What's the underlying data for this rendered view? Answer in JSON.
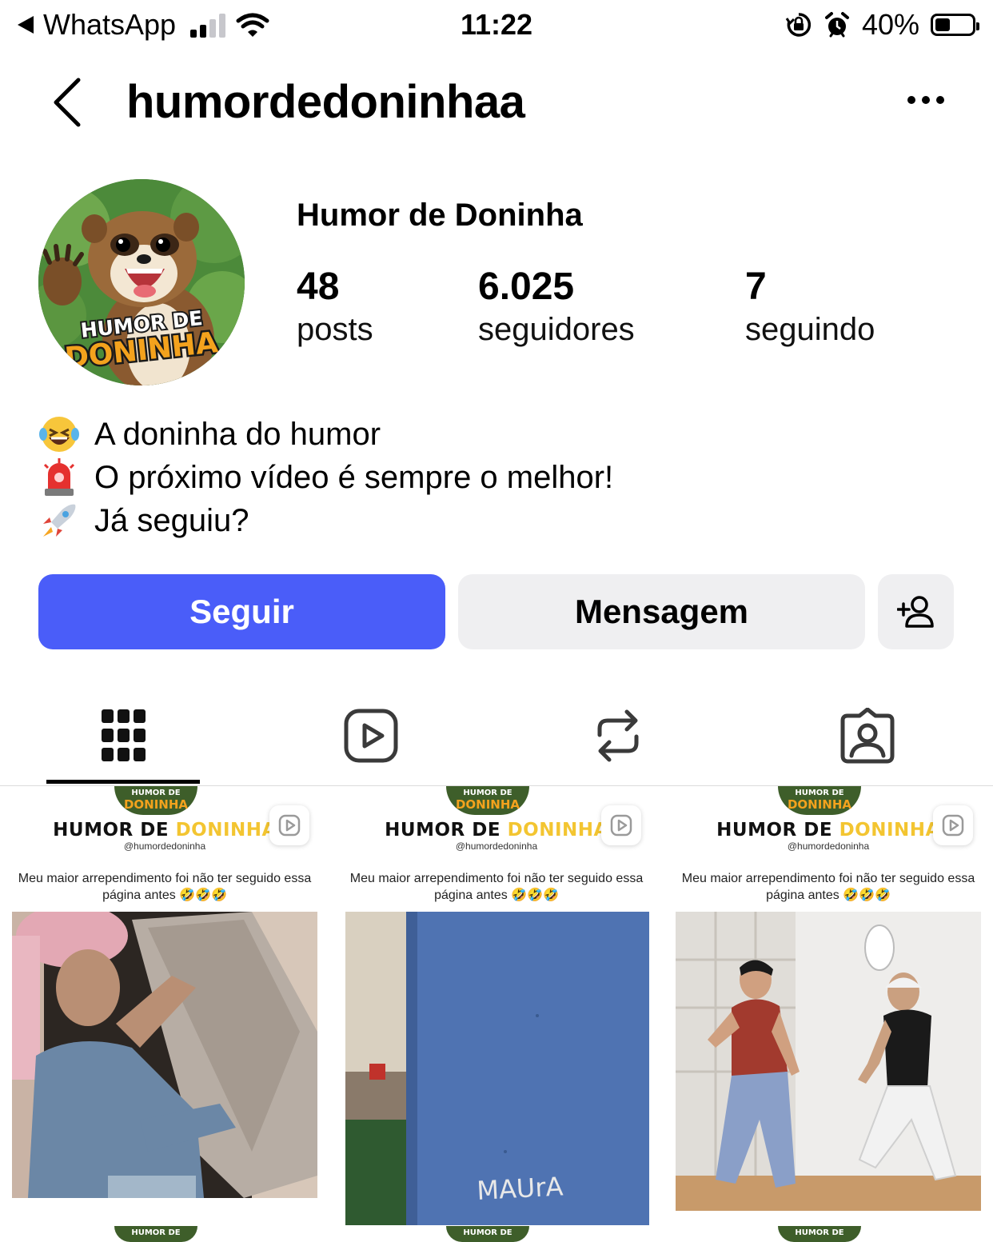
{
  "status_bar": {
    "back_app": "WhatsApp",
    "time": "11:22",
    "battery": "40%",
    "battery_level": 0.4
  },
  "header": {
    "username": "humordedoninhaa",
    "back_icon": "chevron-left-icon",
    "more_icon": "ellipsis-icon"
  },
  "profile": {
    "full_name": "Humor de Doninha",
    "avatar_text_1": "HUMOR DE",
    "avatar_text_2": "DONINHA",
    "stats": [
      {
        "value": "48",
        "label": "posts"
      },
      {
        "value": "6.025",
        "label": "seguidores"
      },
      {
        "value": "7",
        "label": "seguindo"
      }
    ],
    "bio": [
      {
        "icon": "laughing-emoji-icon",
        "text": "A doninha do humor"
      },
      {
        "icon": "siren-emoji-icon",
        "text": "O próximo vídeo é sempre o melhor!"
      },
      {
        "icon": "rocket-emoji-icon",
        "text": "Já seguiu?"
      }
    ]
  },
  "actions": {
    "follow_label": "Seguir",
    "message_label": "Mensagem",
    "add_icon": "add-person-icon"
  },
  "tabs": [
    {
      "name": "tab-posts",
      "icon": "grid-icon",
      "active": true
    },
    {
      "name": "tab-reels",
      "icon": "reels-icon",
      "active": false
    },
    {
      "name": "tab-reposts",
      "icon": "repost-icon",
      "active": false
    },
    {
      "name": "tab-tagged",
      "icon": "tagged-icon",
      "active": false
    }
  ],
  "posts": [
    {
      "logo_1": "HUMOR DE",
      "logo_2": "DONINHA",
      "brand_1": "HUMOR DE",
      "brand_2": "DONINHA",
      "handle": "@humordedoninha",
      "caption": "Meu maior arrependimento foi não ter seguido essa página antes 🤣🤣🤣",
      "scene": "man-with-wall-panel"
    },
    {
      "logo_1": "HUMOR DE",
      "logo_2": "DONINHA",
      "brand_1": "HUMOR DE",
      "brand_2": "DONINHA",
      "handle": "@humordedoninha",
      "caption": "Meu maior arrependimento foi não ter seguido essa página antes 🤣🤣🤣",
      "scene": "blue-door",
      "media_text": "MAUrA"
    },
    {
      "logo_1": "HUMOR DE",
      "logo_2": "DONINHA",
      "brand_1": "HUMOR DE",
      "brand_2": "DONINHA",
      "handle": "@humordedoninha",
      "caption": "Meu maior arrependimento foi não ter seguido essa página antes 🤣🤣🤣",
      "scene": "two-men-dancing"
    }
  ],
  "next_row_logo": "HUMOR DE",
  "colors": {
    "follow_button": "#4a5df9",
    "secondary_button": "#efeff1",
    "brand_yellow": "#f3c531"
  }
}
